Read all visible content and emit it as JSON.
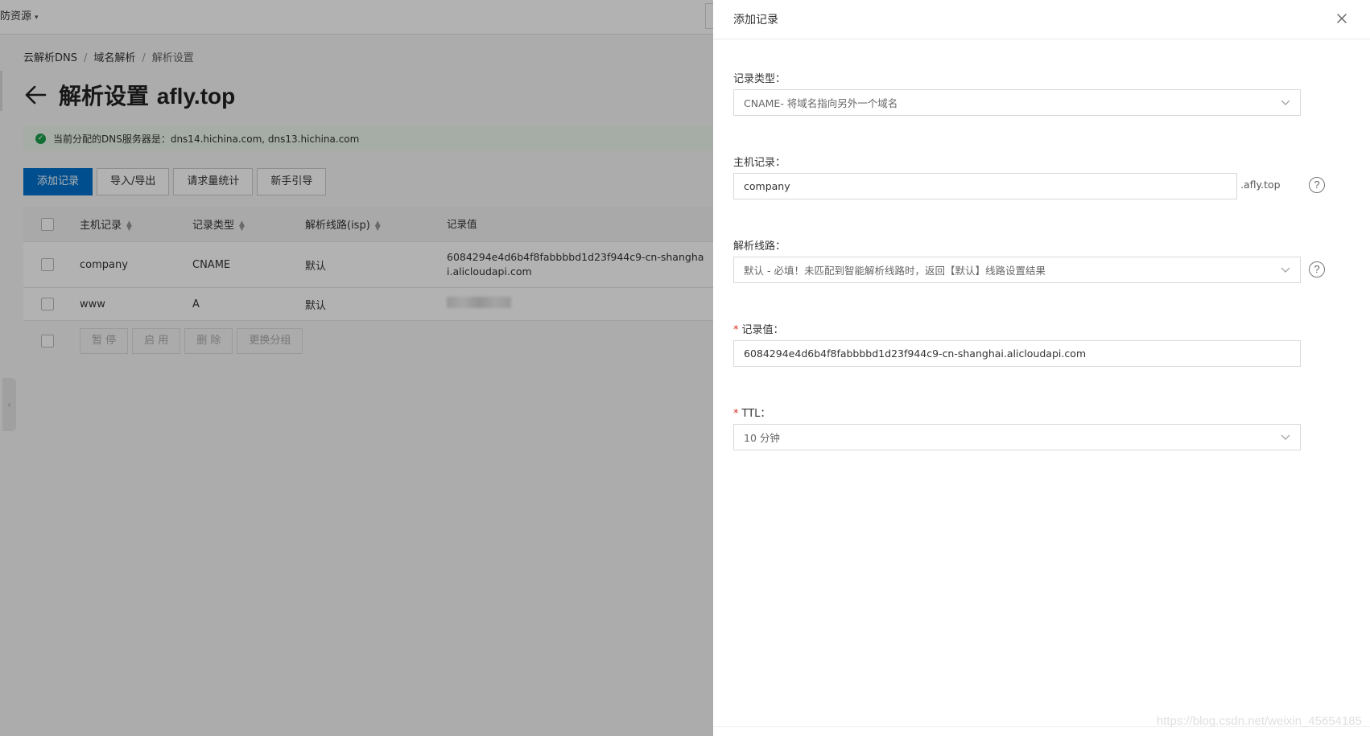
{
  "topbar": {
    "resources_label": "防资源",
    "resources_caret": "▾"
  },
  "breadcrumb": {
    "items": [
      "云解析DNS",
      "域名解析",
      "解析设置"
    ],
    "separator": "/"
  },
  "page": {
    "title_prefix": "解析设置",
    "domain": "afly.top"
  },
  "dns_notice": {
    "text": "当前分配的DNS服务器是：dns14.hichina.com, dns13.hichina.com"
  },
  "toolbar": {
    "add_label": "添加记录",
    "import_label": "导入/导出",
    "stats_label": "请求量统计",
    "guide_label": "新手引导"
  },
  "table": {
    "headers": {
      "host": "主机记录",
      "type": "记录类型",
      "line": "解析线路(isp)",
      "value": "记录值"
    },
    "rows": [
      {
        "host": "company",
        "type": "CNAME",
        "line": "默认",
        "value": "6084294e4d6b4f8fabbbbd1d23f944c9-cn-shanghai.alicloudapi.com"
      },
      {
        "host": "www",
        "type": "A",
        "line": "默认",
        "value": ""
      }
    ],
    "footer": {
      "pause": "暂 停",
      "enable": "启 用",
      "delete": "删 除",
      "change_group": "更换分组"
    }
  },
  "drawer": {
    "title": "添加记录",
    "record_type": {
      "label": "记录类型：",
      "value": "CNAME- 将域名指向另外一个域名"
    },
    "host": {
      "label": "主机记录：",
      "value": "company",
      "suffix": ".afly.top"
    },
    "line": {
      "label": "解析线路：",
      "value": "默认 - 必填！未匹配到智能解析线路时，返回【默认】线路设置结果"
    },
    "record_value": {
      "required": "*",
      "label": "记录值：",
      "value": "6084294e4d6b4f8fabbbbd1d23f944c9-cn-shanghai.alicloudapi.com"
    },
    "ttl": {
      "required": "*",
      "label": "TTL：",
      "value": "10 分钟"
    },
    "help_glyph": "?"
  },
  "watermark": "https://blog.csdn.net/weixin_45654185",
  "colors": {
    "primary": "#0070cc",
    "success": "#1a9e4b",
    "required": "#d93026"
  }
}
